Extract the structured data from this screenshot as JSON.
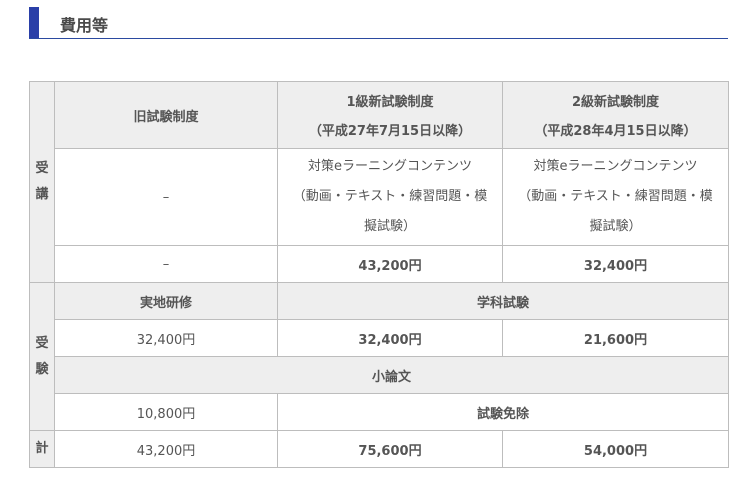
{
  "section": {
    "title": "費用等",
    "accent_color": "#2a3fa8"
  },
  "side": {
    "jukou": [
      "受",
      "講"
    ],
    "juken": [
      "受",
      "験"
    ],
    "total": "計"
  },
  "header": {
    "old": "旧試験制度",
    "grade1_line1": "1級新試験制度",
    "grade1_line2": "（平成27年7月15日以降）",
    "grade2_line1": "2級新試験制度",
    "grade2_line2": "（平成28年4月15日以降）"
  },
  "course": {
    "old": "–",
    "grade1_lines": [
      "対策eラーニングコンテンツ",
      "（動画・テキスト・練習問題・模",
      "擬試験）"
    ],
    "grade2_lines": [
      "対策eラーニングコンテンツ",
      "（動画・テキスト・練習問題・模",
      "擬試験）"
    ]
  },
  "course_fee": {
    "old": "–",
    "grade1": "43,200円",
    "grade2": "32,400円"
  },
  "exam_head": {
    "practical": "実地研修",
    "written": "学科試験"
  },
  "exam_fee": {
    "old": "32,400円",
    "grade1": "32,400円",
    "grade2": "21,600円"
  },
  "essay": {
    "label": "小論文",
    "old": "10,800円",
    "new": "試験免除"
  },
  "total": {
    "old": "43,200円",
    "grade1": "75,600円",
    "grade2": "54,000円"
  }
}
